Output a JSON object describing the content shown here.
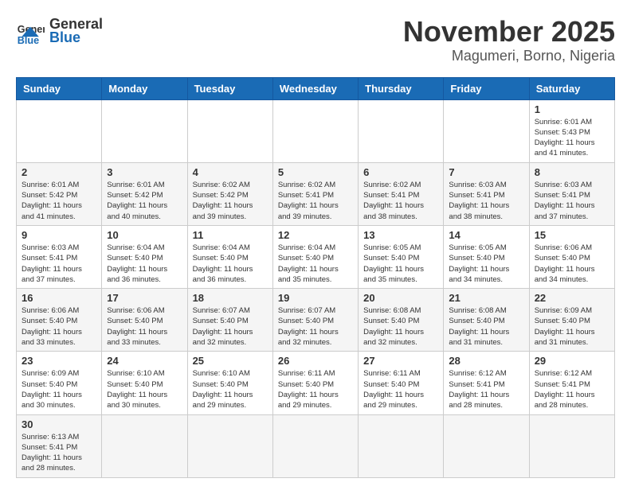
{
  "header": {
    "logo_general": "General",
    "logo_blue": "Blue",
    "month_title": "November 2025",
    "location": "Magumeri, Borno, Nigeria"
  },
  "weekdays": [
    "Sunday",
    "Monday",
    "Tuesday",
    "Wednesday",
    "Thursday",
    "Friday",
    "Saturday"
  ],
  "days": {
    "d1": {
      "num": "1",
      "sunrise": "Sunrise: 6:01 AM",
      "sunset": "Sunset: 5:43 PM",
      "daylight": "Daylight: 11 hours and 41 minutes."
    },
    "d2": {
      "num": "2",
      "sunrise": "Sunrise: 6:01 AM",
      "sunset": "Sunset: 5:42 PM",
      "daylight": "Daylight: 11 hours and 41 minutes."
    },
    "d3": {
      "num": "3",
      "sunrise": "Sunrise: 6:01 AM",
      "sunset": "Sunset: 5:42 PM",
      "daylight": "Daylight: 11 hours and 40 minutes."
    },
    "d4": {
      "num": "4",
      "sunrise": "Sunrise: 6:02 AM",
      "sunset": "Sunset: 5:42 PM",
      "daylight": "Daylight: 11 hours and 39 minutes."
    },
    "d5": {
      "num": "5",
      "sunrise": "Sunrise: 6:02 AM",
      "sunset": "Sunset: 5:41 PM",
      "daylight": "Daylight: 11 hours and 39 minutes."
    },
    "d6": {
      "num": "6",
      "sunrise": "Sunrise: 6:02 AM",
      "sunset": "Sunset: 5:41 PM",
      "daylight": "Daylight: 11 hours and 38 minutes."
    },
    "d7": {
      "num": "7",
      "sunrise": "Sunrise: 6:03 AM",
      "sunset": "Sunset: 5:41 PM",
      "daylight": "Daylight: 11 hours and 38 minutes."
    },
    "d8": {
      "num": "8",
      "sunrise": "Sunrise: 6:03 AM",
      "sunset": "Sunset: 5:41 PM",
      "daylight": "Daylight: 11 hours and 37 minutes."
    },
    "d9": {
      "num": "9",
      "sunrise": "Sunrise: 6:03 AM",
      "sunset": "Sunset: 5:41 PM",
      "daylight": "Daylight: 11 hours and 37 minutes."
    },
    "d10": {
      "num": "10",
      "sunrise": "Sunrise: 6:04 AM",
      "sunset": "Sunset: 5:40 PM",
      "daylight": "Daylight: 11 hours and 36 minutes."
    },
    "d11": {
      "num": "11",
      "sunrise": "Sunrise: 6:04 AM",
      "sunset": "Sunset: 5:40 PM",
      "daylight": "Daylight: 11 hours and 36 minutes."
    },
    "d12": {
      "num": "12",
      "sunrise": "Sunrise: 6:04 AM",
      "sunset": "Sunset: 5:40 PM",
      "daylight": "Daylight: 11 hours and 35 minutes."
    },
    "d13": {
      "num": "13",
      "sunrise": "Sunrise: 6:05 AM",
      "sunset": "Sunset: 5:40 PM",
      "daylight": "Daylight: 11 hours and 35 minutes."
    },
    "d14": {
      "num": "14",
      "sunrise": "Sunrise: 6:05 AM",
      "sunset": "Sunset: 5:40 PM",
      "daylight": "Daylight: 11 hours and 34 minutes."
    },
    "d15": {
      "num": "15",
      "sunrise": "Sunrise: 6:06 AM",
      "sunset": "Sunset: 5:40 PM",
      "daylight": "Daylight: 11 hours and 34 minutes."
    },
    "d16": {
      "num": "16",
      "sunrise": "Sunrise: 6:06 AM",
      "sunset": "Sunset: 5:40 PM",
      "daylight": "Daylight: 11 hours and 33 minutes."
    },
    "d17": {
      "num": "17",
      "sunrise": "Sunrise: 6:06 AM",
      "sunset": "Sunset: 5:40 PM",
      "daylight": "Daylight: 11 hours and 33 minutes."
    },
    "d18": {
      "num": "18",
      "sunrise": "Sunrise: 6:07 AM",
      "sunset": "Sunset: 5:40 PM",
      "daylight": "Daylight: 11 hours and 32 minutes."
    },
    "d19": {
      "num": "19",
      "sunrise": "Sunrise: 6:07 AM",
      "sunset": "Sunset: 5:40 PM",
      "daylight": "Daylight: 11 hours and 32 minutes."
    },
    "d20": {
      "num": "20",
      "sunrise": "Sunrise: 6:08 AM",
      "sunset": "Sunset: 5:40 PM",
      "daylight": "Daylight: 11 hours and 32 minutes."
    },
    "d21": {
      "num": "21",
      "sunrise": "Sunrise: 6:08 AM",
      "sunset": "Sunset: 5:40 PM",
      "daylight": "Daylight: 11 hours and 31 minutes."
    },
    "d22": {
      "num": "22",
      "sunrise": "Sunrise: 6:09 AM",
      "sunset": "Sunset: 5:40 PM",
      "daylight": "Daylight: 11 hours and 31 minutes."
    },
    "d23": {
      "num": "23",
      "sunrise": "Sunrise: 6:09 AM",
      "sunset": "Sunset: 5:40 PM",
      "daylight": "Daylight: 11 hours and 30 minutes."
    },
    "d24": {
      "num": "24",
      "sunrise": "Sunrise: 6:10 AM",
      "sunset": "Sunset: 5:40 PM",
      "daylight": "Daylight: 11 hours and 30 minutes."
    },
    "d25": {
      "num": "25",
      "sunrise": "Sunrise: 6:10 AM",
      "sunset": "Sunset: 5:40 PM",
      "daylight": "Daylight: 11 hours and 29 minutes."
    },
    "d26": {
      "num": "26",
      "sunrise": "Sunrise: 6:11 AM",
      "sunset": "Sunset: 5:40 PM",
      "daylight": "Daylight: 11 hours and 29 minutes."
    },
    "d27": {
      "num": "27",
      "sunrise": "Sunrise: 6:11 AM",
      "sunset": "Sunset: 5:40 PM",
      "daylight": "Daylight: 11 hours and 29 minutes."
    },
    "d28": {
      "num": "28",
      "sunrise": "Sunrise: 6:12 AM",
      "sunset": "Sunset: 5:41 PM",
      "daylight": "Daylight: 11 hours and 28 minutes."
    },
    "d29": {
      "num": "29",
      "sunrise": "Sunrise: 6:12 AM",
      "sunset": "Sunset: 5:41 PM",
      "daylight": "Daylight: 11 hours and 28 minutes."
    },
    "d30": {
      "num": "30",
      "sunrise": "Sunrise: 6:13 AM",
      "sunset": "Sunset: 5:41 PM",
      "daylight": "Daylight: 11 hours and 28 minutes."
    }
  }
}
